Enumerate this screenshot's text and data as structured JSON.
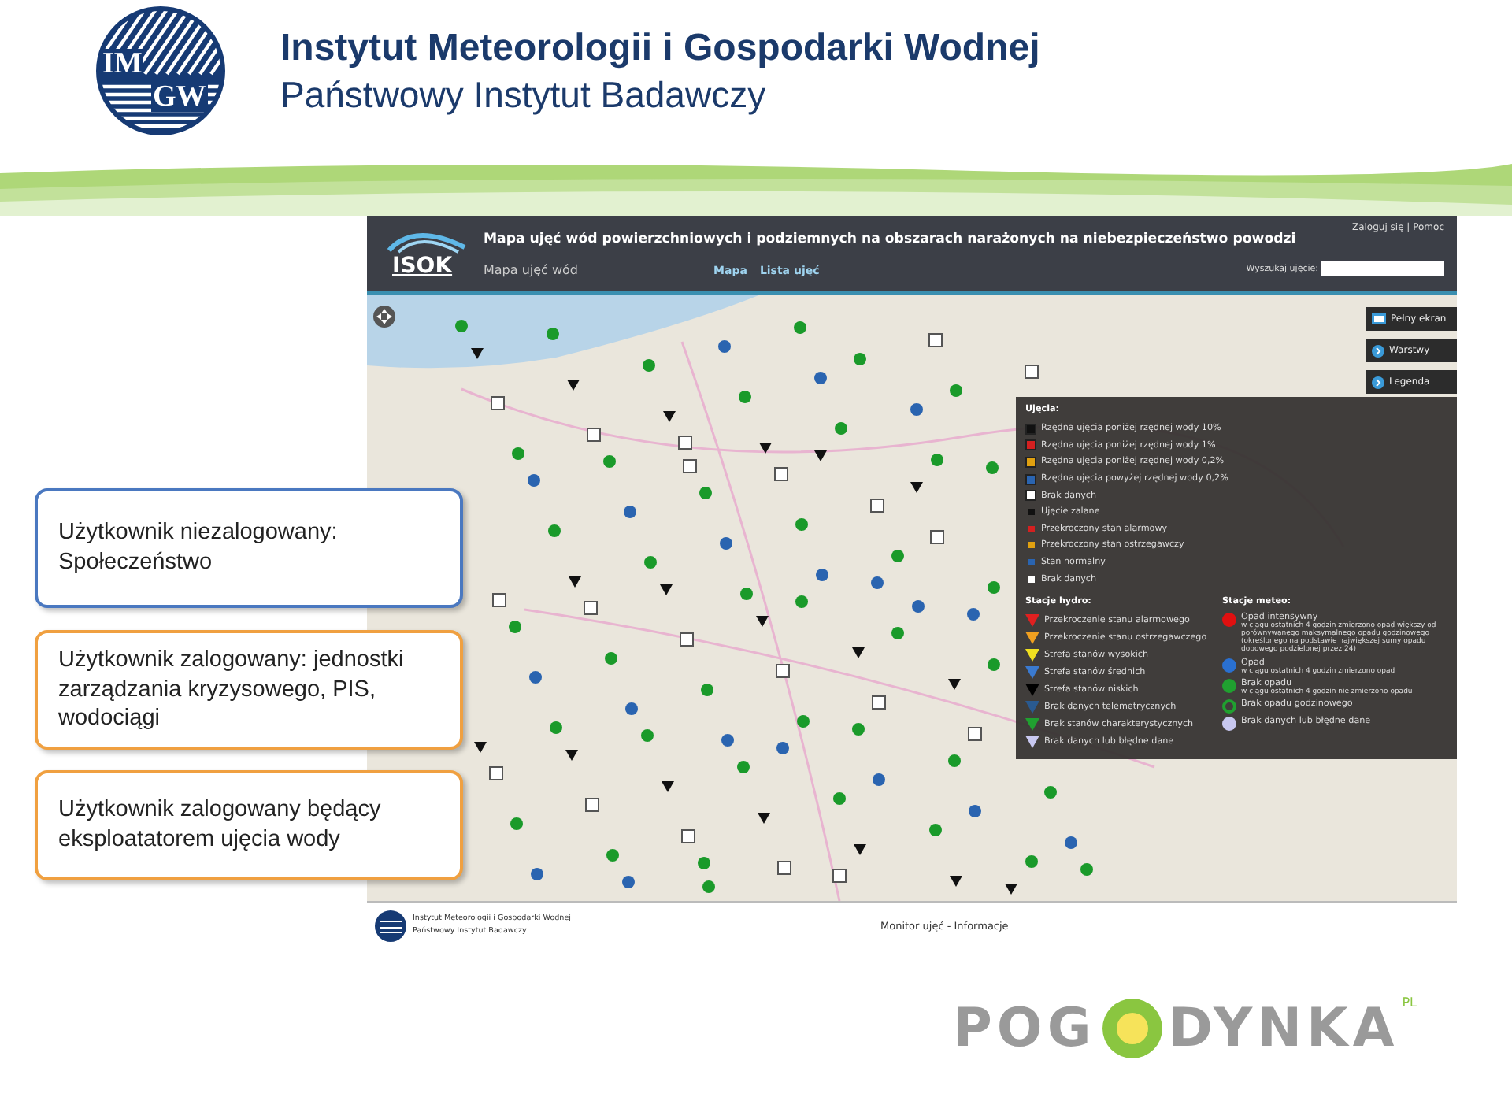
{
  "header": {
    "logo": {
      "top": "IM",
      "bottom": "GW"
    },
    "title": "Instytut Meteorologii i Gospodarki Wodnej",
    "subtitle": "Państwowy Instytut Badawczy"
  },
  "app": {
    "logo_text": "ISOK",
    "title": "Mapa ujęć wód powierzchniowych i podziemnych na obszarach narażonych na niebezpieczeństwo powodzi",
    "subtitle": "Mapa ujęć wód",
    "nav": [
      "Mapa",
      "Lista ujęć"
    ],
    "user_links": "Zaloguj się | Pomoc",
    "search": {
      "label": "Wyszukaj ujęcie:"
    },
    "side_buttons": [
      {
        "label": "Pełny ekran",
        "kind": "fullscreen"
      },
      {
        "label": "Warstwy",
        "kind": "arrow"
      },
      {
        "label": "Legenda",
        "kind": "arrow"
      }
    ],
    "legend": {
      "intakes_title": "Ujęcia:",
      "intakes": [
        {
          "label": "Rzędna ujęcia poniżej rzędnej wody 10%",
          "kind": "square",
          "color": "#111111"
        },
        {
          "label": "Rzędna ujęcia poniżej rzędnej wody 1%",
          "kind": "square",
          "color": "#d42020"
        },
        {
          "label": "Rzędna ujęcia poniżej rzędnej wody 0,2%",
          "kind": "square",
          "color": "#e0a010"
        },
        {
          "label": "Rzędna ujęcia powyżej rzędnej wody 0,2%",
          "kind": "square",
          "color": "#2a64b0"
        },
        {
          "label": "Brak danych",
          "kind": "square",
          "color": "#ffffff"
        },
        {
          "label": "Ujęcie zalane",
          "kind": "dot",
          "color": "#111111"
        },
        {
          "label": "Przekroczony stan alarmowy",
          "kind": "dot",
          "color": "#d42020"
        },
        {
          "label": "Przekroczony stan ostrzegawczy",
          "kind": "dot",
          "color": "#e0a010"
        },
        {
          "label": "Stan normalny",
          "kind": "dot",
          "color": "#2a64b0"
        },
        {
          "label": "Brak danych",
          "kind": "dot",
          "color": "#ffffff"
        }
      ],
      "hydro_title": "Stacje hydro:",
      "hydro": [
        {
          "label": "Przekroczenie stanu alarmowego",
          "color": "#e02020"
        },
        {
          "label": "Przekroczenie stanu ostrzegawczego",
          "color": "#f0a020"
        },
        {
          "label": "Strefa stanów wysokich",
          "color": "#f0e020"
        },
        {
          "label": "Strefa stanów średnich",
          "color": "#3a7ad0"
        },
        {
          "label": "Strefa stanów niskich",
          "color": "#000000"
        },
        {
          "label": "Brak danych telemetrycznych",
          "color": "#2a5a90"
        },
        {
          "label": "Brak stanów charakterystycznych",
          "color": "#20a030"
        },
        {
          "label": "Brak danych lub błędne dane",
          "color": "#c8c8f0"
        }
      ],
      "meteo_title": "Stacje meteo:",
      "meteo": [
        {
          "label": "Opad intensywny",
          "note": "w ciągu ostatnich 4 godzin zmierzono opad większy od porównywanego maksymalnego opadu godzinowego (określonego na podstawie największej sumy opadu dobowego podzielonej przez 24)",
          "kind": "dot",
          "color": "#e01010"
        },
        {
          "label": "Opad",
          "note": "w ciągu ostatnich 4 godzin zmierzono opad",
          "kind": "dot",
          "color": "#2a70d0"
        },
        {
          "label": "Brak opadu",
          "note": "w ciągu ostatnich 4 godzin nie zmierzono opadu",
          "kind": "dot",
          "color": "#20a030"
        },
        {
          "label": "Brak opadu godzinowego",
          "kind": "ring",
          "color": "#20a030"
        },
        {
          "label": "Brak danych lub błędne dane",
          "kind": "dot",
          "color": "#c8c8f0"
        }
      ]
    },
    "footer": {
      "org_line1": "Instytut Meteorologii i Gospodarki Wodnej",
      "org_line2": "Państwowy Instytut Badawczy",
      "link": "Monitor ujęć - Informacje"
    }
  },
  "callouts": [
    {
      "text": "Użytkownik niezalogowany: Społeczeństwo",
      "color": "#4a78c0"
    },
    {
      "text": "Użytkownik zalogowany: jednostki zarządzania kryzysowego, PIS, wodociągi",
      "color": "#f0a040"
    },
    {
      "text": "Użytkownik zalogowany będący eksploatatorem ujęcia wody",
      "color": "#f0a040"
    }
  ],
  "bottom_logo": {
    "left": "POG",
    "right": "DYNKA",
    "sup": "PL"
  }
}
